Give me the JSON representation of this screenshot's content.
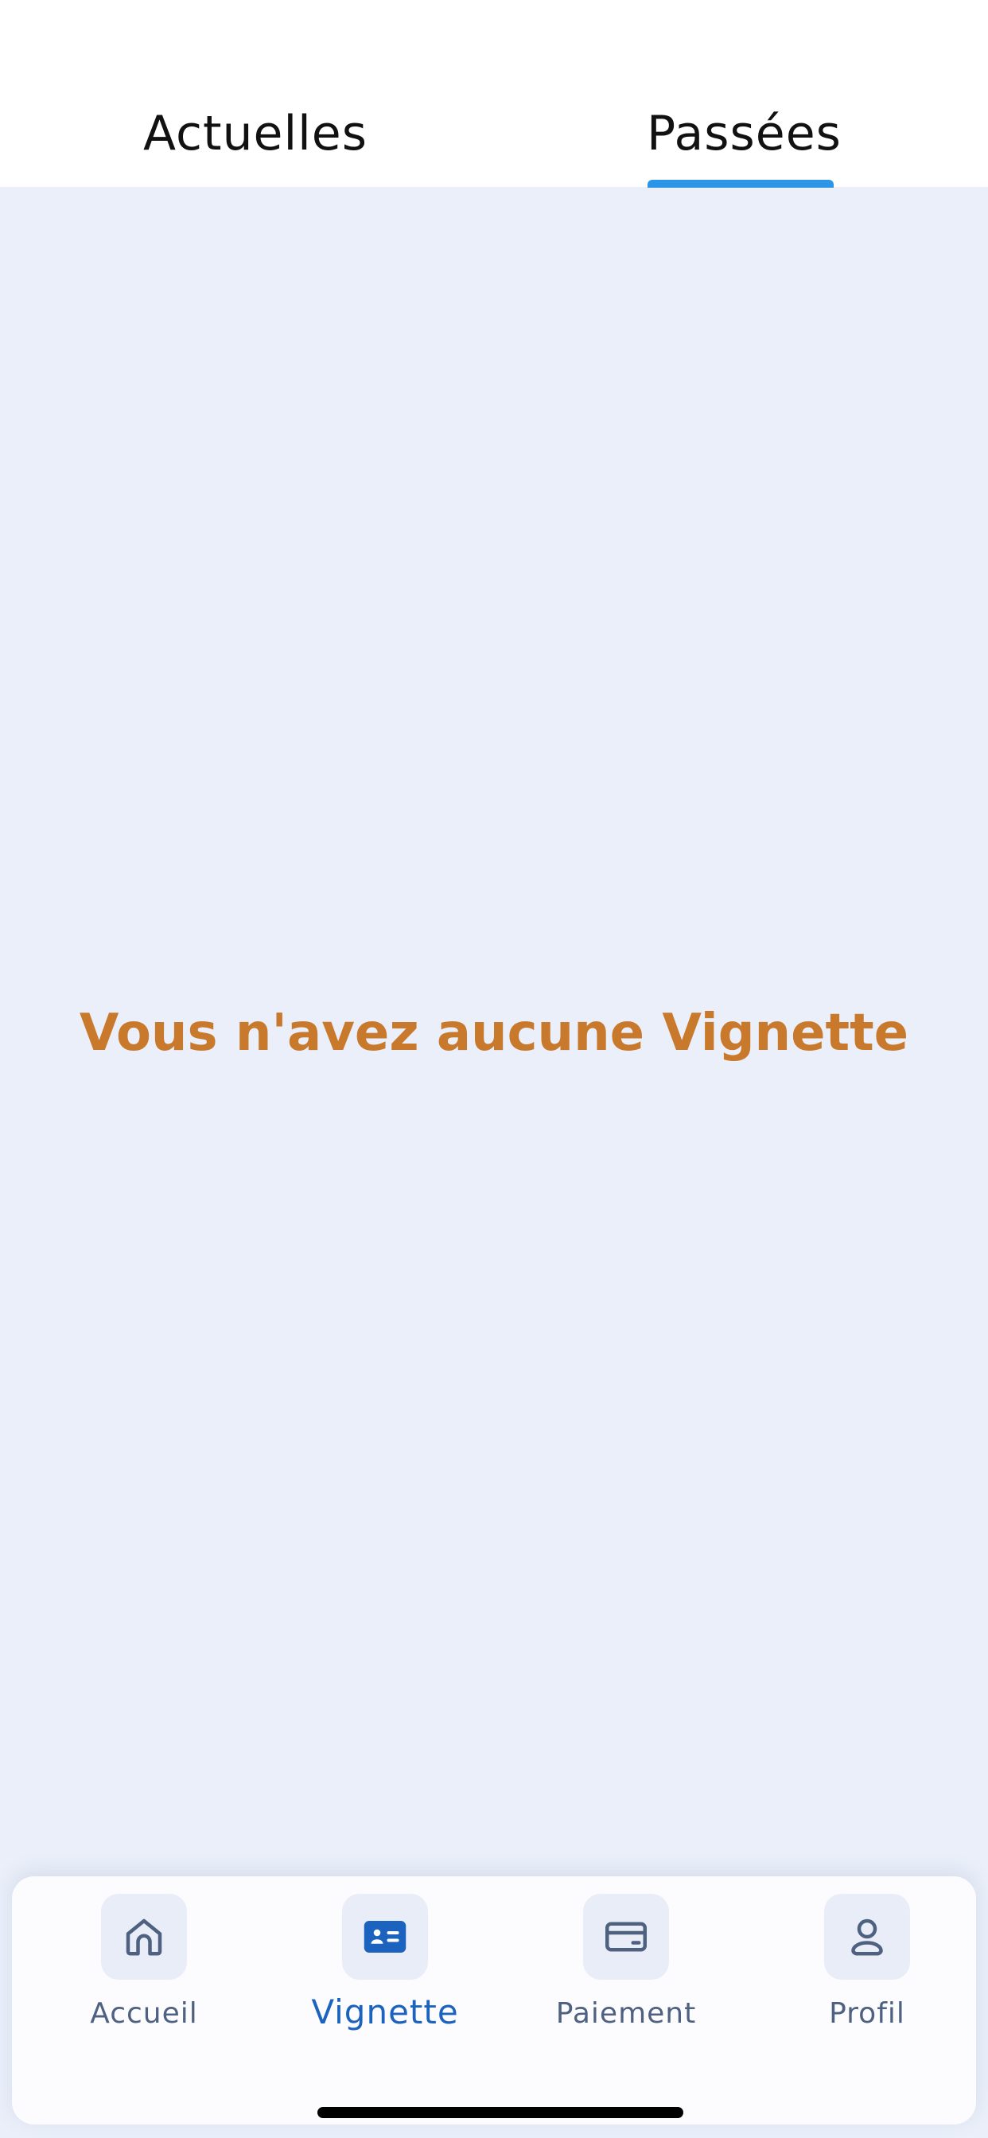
{
  "tabs": {
    "current_label": "Actuelles",
    "past_label": "Passées",
    "active": "Passées",
    "indicator_color": "#2b95e8"
  },
  "main": {
    "empty_message": "Vous n'avez aucune Vignette",
    "empty_message_color": "#c8792c"
  },
  "bottom_nav": {
    "active_item": "Vignette",
    "items": [
      {
        "label": "Accueil",
        "icon": "home-icon"
      },
      {
        "label": "Vignette",
        "icon": "id-card-icon"
      },
      {
        "label": "Paiement",
        "icon": "credit-card-icon"
      },
      {
        "label": "Profil",
        "icon": "user-icon"
      }
    ],
    "active_color": "#1c63bf",
    "inactive_color": "#4f6180"
  }
}
